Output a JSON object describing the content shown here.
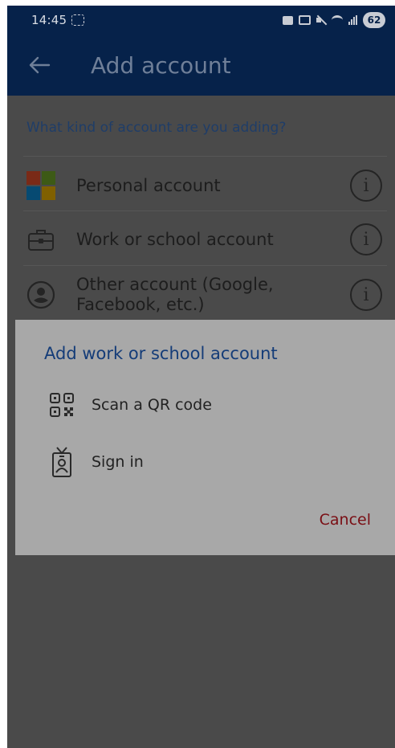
{
  "status_bar": {
    "time": "14:45",
    "battery": "62"
  },
  "app_bar": {
    "title": "Add account",
    "back_icon": "arrow-left-icon"
  },
  "account_list": {
    "prompt": "What kind of account are you adding?",
    "items": [
      {
        "label": "Personal account",
        "icon": "microsoft-logo-icon"
      },
      {
        "label": "Work or school account",
        "icon": "briefcase-icon"
      },
      {
        "label_line1": "Other account (Google,",
        "label_line2": "Facebook, etc.)",
        "icon": "person-circle-icon"
      }
    ],
    "info_glyph": "i"
  },
  "dialog": {
    "title": "Add work or school account",
    "options": [
      {
        "label": "Scan a QR code",
        "icon": "qr-code-icon"
      },
      {
        "label": "Sign in",
        "icon": "id-badge-icon"
      }
    ],
    "cancel_label": "Cancel"
  },
  "colors": {
    "app_bar": "#06224a",
    "dialog_title": "#143c78",
    "cancel": "#7a0e14",
    "scrim": "#4a4a4a",
    "dialog_bg": "#a8a8a8"
  }
}
